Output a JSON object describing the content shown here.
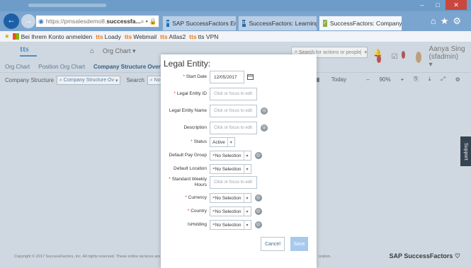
{
  "browser": {
    "url_bold": "successfa...",
    "url_prefix": "https://pmsalesdemo8.",
    "tabs": [
      {
        "label": "SAP SuccessFactors Employee ..."
      },
      {
        "label": "SuccessFactors: Learning Conte..."
      },
      {
        "label": "SuccessFactors: Company St..."
      }
    ],
    "favorites": {
      "konto": "Bei Ihrem Konto anmelden",
      "items": [
        "Loady",
        "Webmail",
        "Atlas2",
        "tts VPN"
      ],
      "tts": "tts"
    }
  },
  "app": {
    "logo": "tts",
    "menu": "Org Chart",
    "search_placeholder": "Search for actions or people",
    "user": "Aanya Sing (sfadmin)",
    "badges": {
      "notif": "8",
      "todo": "8"
    },
    "subnav": [
      "Org Chart",
      "Position Org Chart",
      "Company Structure Overview",
      "De"
    ],
    "toolbar": {
      "company_structure_label": "Company Structure",
      "company_structure_value": "Company Structure Ov",
      "search_label": "Search",
      "search_value": "No Selectio",
      "today": "Today",
      "zoom": "90%",
      "minus": "–",
      "plus": "+"
    },
    "footer": "Copyright © 2017 SuccessFactors, Inc. All rights reserved. These online services are SuccessFactors",
    "footer_end": "ization.",
    "brand": "SAP SuccessFactors",
    "support": "Support"
  },
  "modal": {
    "title": "Legal Entity:",
    "placeholder": "Click or focus to edit",
    "fields": {
      "start_date": {
        "label": "Start Date",
        "value": "12/05/2017"
      },
      "legal_entity_id": {
        "label": "Legal Entity ID"
      },
      "legal_entity_name": {
        "label": "Legal Entity Name"
      },
      "description": {
        "label": "Description"
      },
      "status": {
        "label": "Status",
        "value": "Active"
      },
      "default_pay_group": {
        "label": "Default Pay Group",
        "value": "No Selection"
      },
      "default_location": {
        "label": "Default Location",
        "value": "No Selection"
      },
      "standard_weekly_hours": {
        "label": "Standard Weekly Hours"
      },
      "currency": {
        "label": "Currency",
        "value": "No Selection"
      },
      "country": {
        "label": "Country",
        "value": "No Selection"
      },
      "isholding": {
        "label": "IsHolding",
        "value": "No Selection"
      }
    },
    "cancel": "Cancel",
    "save": "Save",
    "required_mark": "*"
  }
}
